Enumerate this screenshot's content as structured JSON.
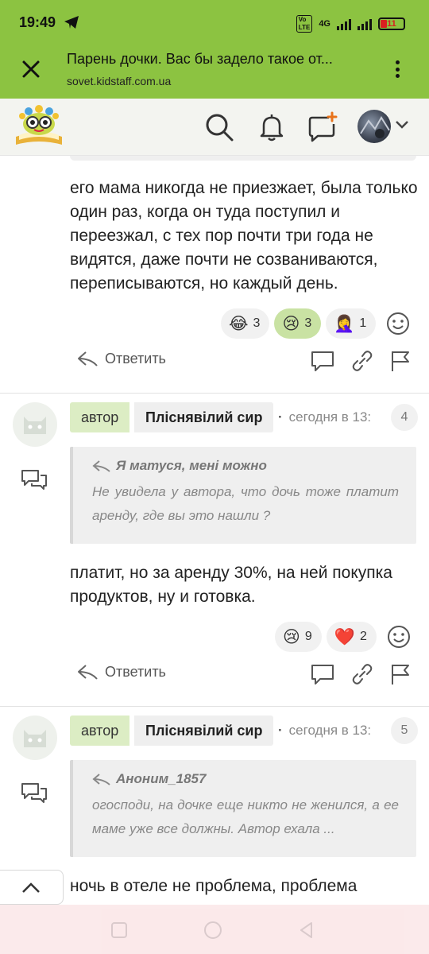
{
  "status_bar": {
    "time": "19:49",
    "network": "4G",
    "battery": "11"
  },
  "browser": {
    "title": "Парень дочки. Вас бы задело такое от...",
    "url": "sovet.kidstaff.com.ua"
  },
  "colors": {
    "brand_green": "#8cc341",
    "author_badge": "#dcedc4",
    "active_reaction": "#c9e2a3"
  },
  "post1": {
    "body": "его мама никогда не приезжает, была только один раз, когда он туда поступил и переезжал, с тех пор почти три года не видятся, даже почти не созваниваются, переписываются, но каждый день.",
    "reactions": [
      {
        "emoji": "😂",
        "count": "3",
        "active": false
      },
      {
        "emoji": "😢",
        "count": "3",
        "active": true
      },
      {
        "emoji": "🤦‍♀️",
        "count": "1",
        "active": false
      }
    ],
    "reply_label": "Ответить"
  },
  "post2": {
    "badge": "автор",
    "author": "Плicнявiлий сир",
    "date": "сегодня в 13:",
    "number": "4",
    "quote_author": "Я матуся, мені можно",
    "quote_text": "Не увидела у автора, что дочь тоже платит аренду, где вы это нашли ?",
    "body": "платит, но за аренду 30%, на ней покупка продуктов, ну и готовка.",
    "reactions": [
      {
        "emoji": "😢",
        "count": "9",
        "active": false
      },
      {
        "emoji": "❤️",
        "count": "2",
        "active": false
      }
    ],
    "reply_label": "Ответить"
  },
  "post3": {
    "badge": "автор",
    "author": "Плiснявiлий сир",
    "date": "сегодня в 13:",
    "number": "5",
    "quote_author": "Аноним_1857",
    "quote_text": "огосподи, на дочке еще никто не женился, а ее маме уже все должны. Автор ехала ...",
    "body": "ночь в отеле не проблема, проблема"
  }
}
